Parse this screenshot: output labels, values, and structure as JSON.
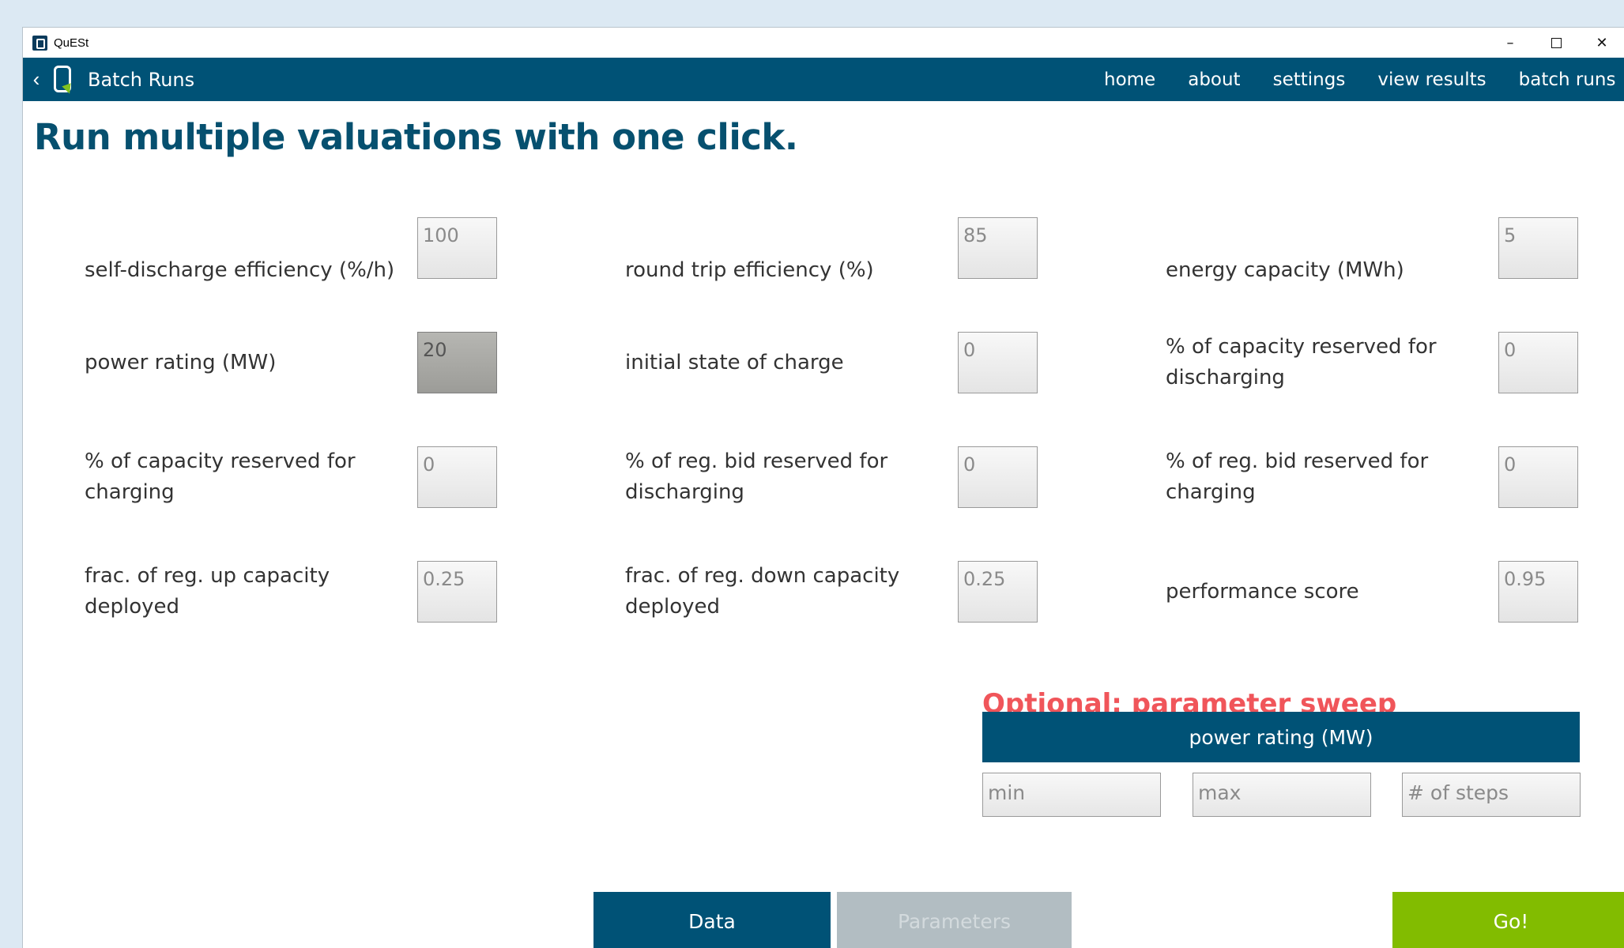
{
  "window": {
    "title": "QuESt",
    "minimize": "–",
    "close": "✕"
  },
  "nav": {
    "back": "‹",
    "title": "Batch Runs",
    "links": [
      "home",
      "about",
      "settings",
      "view results",
      "batch runs"
    ]
  },
  "page": {
    "heading": "Run multiple valuations with one click."
  },
  "params": [
    {
      "label": "self-discharge efficiency (%/h)",
      "value": "100"
    },
    {
      "label": "round trip efficiency (%)",
      "value": "85"
    },
    {
      "label": "energy capacity (MWh)",
      "value": "5"
    },
    {
      "label": "power rating (MW)",
      "value": "20"
    },
    {
      "label": "initial state of charge",
      "value": "0"
    },
    {
      "label": "% of capacity reserved for discharging",
      "value": "0"
    },
    {
      "label": "% of capacity reserved for charging",
      "value": "0"
    },
    {
      "label": "% of reg. bid reserved for discharging",
      "value": "0"
    },
    {
      "label": "% of reg. bid reserved for charging",
      "value": "0"
    },
    {
      "label": "frac. of reg. up capacity deployed",
      "value": "0.25"
    },
    {
      "label": "frac. of reg. down capacity deployed",
      "value": "0.25"
    },
    {
      "label": "performance score",
      "value": "0.95"
    }
  ],
  "sweep": {
    "title": "Optional: parameter sweep",
    "parameter": "power rating (MW)",
    "min_placeholder": "min",
    "max_placeholder": "max",
    "steps_placeholder": "# of steps"
  },
  "tabs": {
    "data": "Data",
    "parameters": "Parameters"
  },
  "go": "Go!"
}
